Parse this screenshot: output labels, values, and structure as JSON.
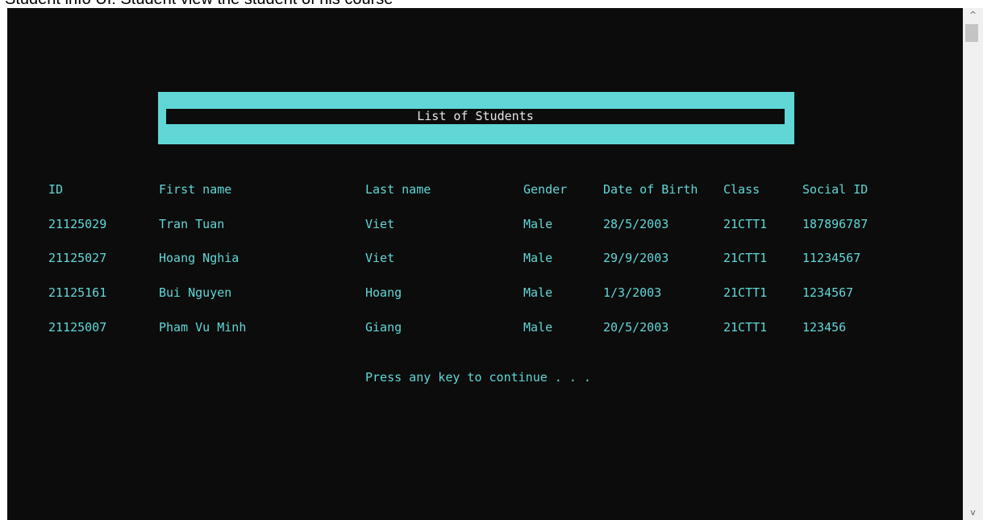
{
  "window": {
    "cut_title": "Student info UI: Student view the student of his course"
  },
  "console": {
    "title": "List of Students",
    "headers": [
      "ID",
      "First name",
      "Last name",
      "Gender",
      "Date of Birth",
      "Class",
      "Social ID"
    ],
    "rows": [
      [
        "21125029",
        "Tran Tuan",
        "Viet",
        "Male",
        "28/5/2003",
        "21CTT1",
        "187896787"
      ],
      [
        "21125027",
        "Hoang Nghia",
        "Viet",
        "Male",
        "29/9/2003",
        "21CTT1",
        "11234567"
      ],
      [
        "21125161",
        "Bui Nguyen",
        "Hoang",
        "Male",
        "1/3/2003",
        "21CTT1",
        "1234567"
      ],
      [
        "21125007",
        "Pham Vu Minh",
        "Giang",
        "Male",
        "20/5/2003",
        "21CTT1",
        "123456"
      ]
    ],
    "prompt": "Press any key to continue . . ."
  },
  "scrollbar": {
    "up_icon": "chevron-up-icon",
    "down_icon": "chevron-down-icon",
    "up_glyph": "^",
    "down_glyph": "v"
  },
  "colors": {
    "background": "#0c0c0c",
    "accent": "#61d6d6",
    "title_text": "#e6e6e6"
  }
}
